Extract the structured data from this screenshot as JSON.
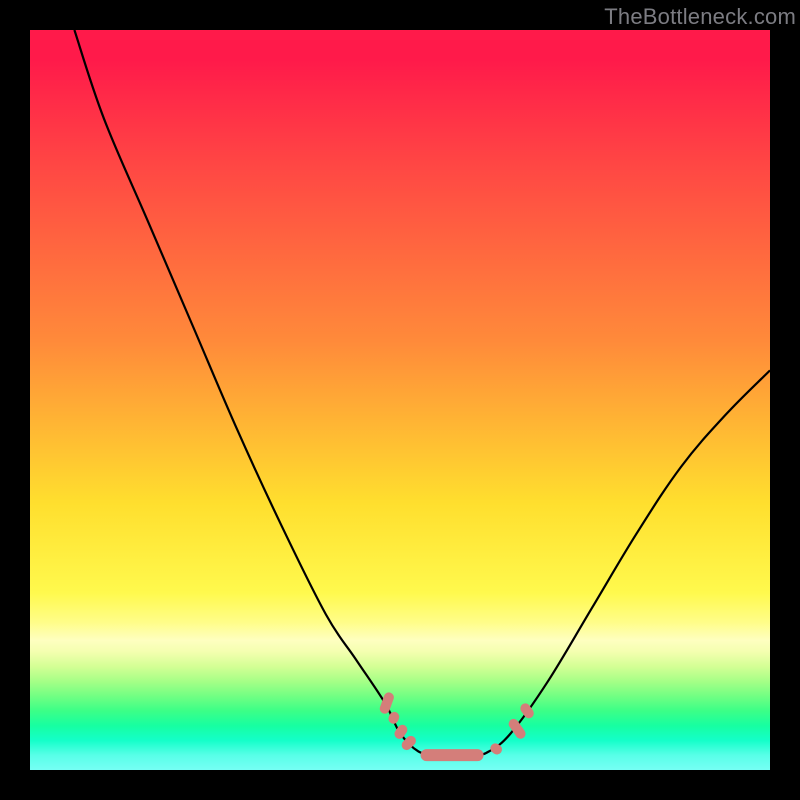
{
  "watermark": "TheBottleneck.com",
  "chart_data": {
    "type": "line",
    "title": "",
    "xlabel": "",
    "ylabel": "",
    "xlim": [
      0,
      100
    ],
    "ylim": [
      0,
      100
    ],
    "series": [
      {
        "name": "curve",
        "x": [
          6,
          10,
          16,
          22,
          28,
          34,
          40,
          44,
          48,
          50,
          52.5,
          55,
          57,
          60,
          62,
          65,
          70,
          76,
          82,
          88,
          94,
          100
        ],
        "y": [
          100,
          88,
          74,
          60,
          46,
          33,
          21,
          15,
          9,
          5,
          2.5,
          2,
          2,
          2,
          2.5,
          5,
          12,
          22,
          32,
          41,
          48,
          54
        ]
      }
    ],
    "markers": {
      "points": [
        {
          "x": 48.2,
          "y": 9.0,
          "w": 3.0,
          "h": 1.4,
          "rot": -70
        },
        {
          "x": 49.2,
          "y": 7.0,
          "w": 1.6,
          "h": 1.4,
          "rot": -65
        },
        {
          "x": 50.1,
          "y": 5.2,
          "w": 2.0,
          "h": 1.4,
          "rot": -55
        },
        {
          "x": 51.2,
          "y": 3.6,
          "w": 2.2,
          "h": 1.4,
          "rot": -45
        },
        {
          "x": 57.0,
          "y": 2.0,
          "w": 8.5,
          "h": 1.6,
          "rot": 0
        },
        {
          "x": 63.0,
          "y": 2.8,
          "w": 1.6,
          "h": 1.4,
          "rot": 35
        },
        {
          "x": 65.8,
          "y": 5.6,
          "w": 3.0,
          "h": 1.4,
          "rot": 55
        },
        {
          "x": 67.2,
          "y": 8.0,
          "w": 2.2,
          "h": 1.4,
          "rot": 55
        }
      ]
    }
  }
}
